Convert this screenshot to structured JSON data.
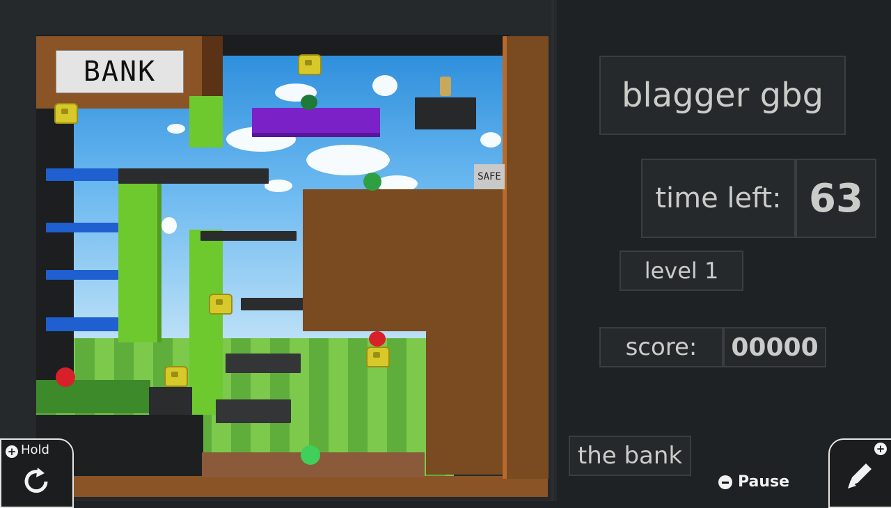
{
  "game": {
    "bank_sign": "BANK",
    "safe_sign": "SAFE"
  },
  "hud": {
    "title": "blagger gbg",
    "time_label": "time left:",
    "time_value": "63",
    "level": "level 1",
    "score_label": "score:",
    "score_value": "00000",
    "stage_name": "the bank"
  },
  "controls": {
    "hold_label": "Hold",
    "pause_label": "Pause",
    "hold_icon": "rotate-icon",
    "edit_icon": "pencil-icon"
  },
  "colors": {
    "panel_text": "#c9ccc8",
    "gem_green": "#2ea043",
    "gem_red": "#d8202a",
    "figure_yellow": "#d8c92a",
    "platform_purple": "#7a22c8",
    "platform_blue": "#1f5fd0",
    "wall_brown": "#7a4a20"
  }
}
